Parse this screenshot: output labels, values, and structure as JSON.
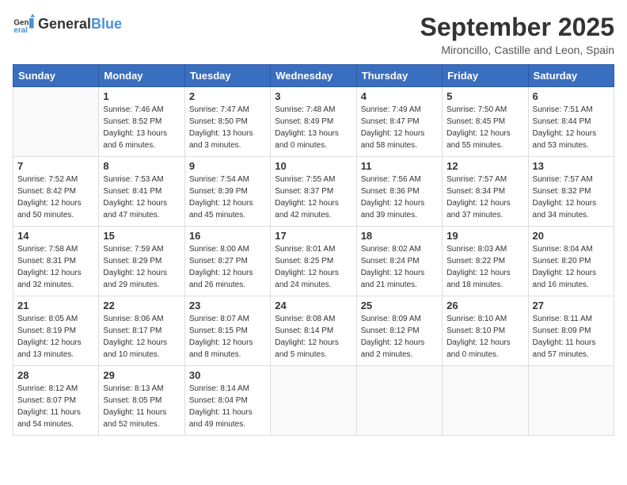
{
  "logo": {
    "text_general": "General",
    "text_blue": "Blue"
  },
  "title": "September 2025",
  "subtitle": "Mironcillo, Castille and Leon, Spain",
  "header_days": [
    "Sunday",
    "Monday",
    "Tuesday",
    "Wednesday",
    "Thursday",
    "Friday",
    "Saturday"
  ],
  "weeks": [
    [
      {
        "day": "",
        "info": ""
      },
      {
        "day": "1",
        "info": "Sunrise: 7:46 AM\nSunset: 8:52 PM\nDaylight: 13 hours\nand 6 minutes."
      },
      {
        "day": "2",
        "info": "Sunrise: 7:47 AM\nSunset: 8:50 PM\nDaylight: 13 hours\nand 3 minutes."
      },
      {
        "day": "3",
        "info": "Sunrise: 7:48 AM\nSunset: 8:49 PM\nDaylight: 13 hours\nand 0 minutes."
      },
      {
        "day": "4",
        "info": "Sunrise: 7:49 AM\nSunset: 8:47 PM\nDaylight: 12 hours\nand 58 minutes."
      },
      {
        "day": "5",
        "info": "Sunrise: 7:50 AM\nSunset: 8:45 PM\nDaylight: 12 hours\nand 55 minutes."
      },
      {
        "day": "6",
        "info": "Sunrise: 7:51 AM\nSunset: 8:44 PM\nDaylight: 12 hours\nand 53 minutes."
      }
    ],
    [
      {
        "day": "7",
        "info": "Sunrise: 7:52 AM\nSunset: 8:42 PM\nDaylight: 12 hours\nand 50 minutes."
      },
      {
        "day": "8",
        "info": "Sunrise: 7:53 AM\nSunset: 8:41 PM\nDaylight: 12 hours\nand 47 minutes."
      },
      {
        "day": "9",
        "info": "Sunrise: 7:54 AM\nSunset: 8:39 PM\nDaylight: 12 hours\nand 45 minutes."
      },
      {
        "day": "10",
        "info": "Sunrise: 7:55 AM\nSunset: 8:37 PM\nDaylight: 12 hours\nand 42 minutes."
      },
      {
        "day": "11",
        "info": "Sunrise: 7:56 AM\nSunset: 8:36 PM\nDaylight: 12 hours\nand 39 minutes."
      },
      {
        "day": "12",
        "info": "Sunrise: 7:57 AM\nSunset: 8:34 PM\nDaylight: 12 hours\nand 37 minutes."
      },
      {
        "day": "13",
        "info": "Sunrise: 7:57 AM\nSunset: 8:32 PM\nDaylight: 12 hours\nand 34 minutes."
      }
    ],
    [
      {
        "day": "14",
        "info": "Sunrise: 7:58 AM\nSunset: 8:31 PM\nDaylight: 12 hours\nand 32 minutes."
      },
      {
        "day": "15",
        "info": "Sunrise: 7:59 AM\nSunset: 8:29 PM\nDaylight: 12 hours\nand 29 minutes."
      },
      {
        "day": "16",
        "info": "Sunrise: 8:00 AM\nSunset: 8:27 PM\nDaylight: 12 hours\nand 26 minutes."
      },
      {
        "day": "17",
        "info": "Sunrise: 8:01 AM\nSunset: 8:25 PM\nDaylight: 12 hours\nand 24 minutes."
      },
      {
        "day": "18",
        "info": "Sunrise: 8:02 AM\nSunset: 8:24 PM\nDaylight: 12 hours\nand 21 minutes."
      },
      {
        "day": "19",
        "info": "Sunrise: 8:03 AM\nSunset: 8:22 PM\nDaylight: 12 hours\nand 18 minutes."
      },
      {
        "day": "20",
        "info": "Sunrise: 8:04 AM\nSunset: 8:20 PM\nDaylight: 12 hours\nand 16 minutes."
      }
    ],
    [
      {
        "day": "21",
        "info": "Sunrise: 8:05 AM\nSunset: 8:19 PM\nDaylight: 12 hours\nand 13 minutes."
      },
      {
        "day": "22",
        "info": "Sunrise: 8:06 AM\nSunset: 8:17 PM\nDaylight: 12 hours\nand 10 minutes."
      },
      {
        "day": "23",
        "info": "Sunrise: 8:07 AM\nSunset: 8:15 PM\nDaylight: 12 hours\nand 8 minutes."
      },
      {
        "day": "24",
        "info": "Sunrise: 8:08 AM\nSunset: 8:14 PM\nDaylight: 12 hours\nand 5 minutes."
      },
      {
        "day": "25",
        "info": "Sunrise: 8:09 AM\nSunset: 8:12 PM\nDaylight: 12 hours\nand 2 minutes."
      },
      {
        "day": "26",
        "info": "Sunrise: 8:10 AM\nSunset: 8:10 PM\nDaylight: 12 hours\nand 0 minutes."
      },
      {
        "day": "27",
        "info": "Sunrise: 8:11 AM\nSunset: 8:09 PM\nDaylight: 11 hours\nand 57 minutes."
      }
    ],
    [
      {
        "day": "28",
        "info": "Sunrise: 8:12 AM\nSunset: 8:07 PM\nDaylight: 11 hours\nand 54 minutes."
      },
      {
        "day": "29",
        "info": "Sunrise: 8:13 AM\nSunset: 8:05 PM\nDaylight: 11 hours\nand 52 minutes."
      },
      {
        "day": "30",
        "info": "Sunrise: 8:14 AM\nSunset: 8:04 PM\nDaylight: 11 hours\nand 49 minutes."
      },
      {
        "day": "",
        "info": ""
      },
      {
        "day": "",
        "info": ""
      },
      {
        "day": "",
        "info": ""
      },
      {
        "day": "",
        "info": ""
      }
    ]
  ]
}
